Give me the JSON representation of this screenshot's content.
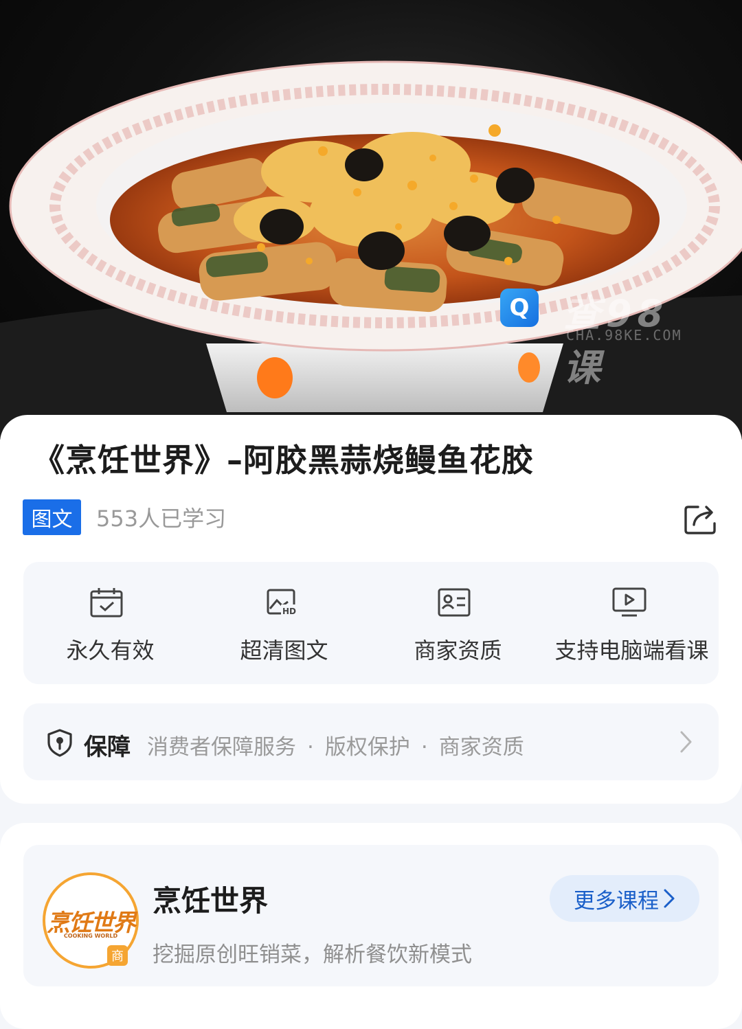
{
  "hero": {
    "image": "braised eel dish with black garlic in white plate",
    "watermark": {
      "logo_icon": "q-logo-icon",
      "name": "查98课",
      "domain": "CHA.98KE.COM"
    }
  },
  "course": {
    "title": "《烹饪世界》–阿胶黑蒜烧鳗鱼花胶",
    "tag": "图文",
    "learners": "553人已学习",
    "share_icon": "share-icon"
  },
  "features": [
    {
      "icon": "calendar-check-icon",
      "label": "永久有效"
    },
    {
      "icon": "hd-image-icon",
      "label": "超清图文"
    },
    {
      "icon": "id-card-icon",
      "label": "商家资质"
    },
    {
      "icon": "monitor-play-icon",
      "label": "支持电脑端看课"
    }
  ],
  "guarantee": {
    "icon": "shield-icon",
    "label": "保障",
    "items": [
      "消费者保障服务",
      "版权保护",
      "商家资质"
    ],
    "separator": "·"
  },
  "merchant": {
    "logo_text": "烹饪世界",
    "logo_subtext": "COOKING WORLD",
    "logo_badge": "商",
    "name": "烹饪世界",
    "description": "挖掘原创旺销菜，解析餐饮新模式",
    "more_button": "更多课程"
  },
  "colors": {
    "accent_blue": "#1a6ee8",
    "merchant_orange": "#f5a532"
  }
}
